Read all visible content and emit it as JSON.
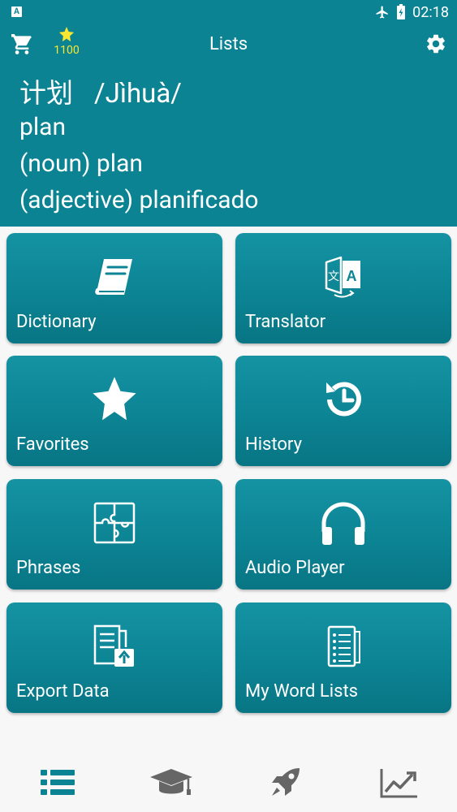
{
  "status_bar": {
    "left_icon_letter": "A",
    "time": "02:18",
    "icons": [
      "airplane-icon",
      "battery-charging-icon"
    ]
  },
  "header": {
    "title": "Lists",
    "points": "1100",
    "icons": {
      "cart": "cart-icon",
      "star": "star-icon",
      "settings": "gear-icon"
    }
  },
  "word": {
    "hanzi": "计划",
    "pinyin": "/Jìhuà/",
    "definitions": [
      "plan",
      "(noun) plan",
      "(adjective) planificado"
    ]
  },
  "tiles": [
    {
      "label": "Dictionary",
      "icon": "book-icon"
    },
    {
      "label": "Translator",
      "icon": "translate-icon"
    },
    {
      "label": "Favorites",
      "icon": "star-icon"
    },
    {
      "label": "History",
      "icon": "history-icon"
    },
    {
      "label": "Phrases",
      "icon": "puzzle-icon"
    },
    {
      "label": "Audio Player",
      "icon": "headphones-icon"
    },
    {
      "label": "Export Data",
      "icon": "export-document-icon"
    },
    {
      "label": "My Word Lists",
      "icon": "word-list-icon"
    }
  ],
  "bottom_nav": {
    "items": [
      {
        "icon": "list-icon",
        "active": true
      },
      {
        "icon": "graduation-cap-icon",
        "active": false
      },
      {
        "icon": "rocket-icon",
        "active": false
      },
      {
        "icon": "trend-chart-icon",
        "active": false
      }
    ]
  },
  "colors": {
    "primary": "#0b8392",
    "tile_gradient_top": "#1593a3",
    "tile_gradient_bottom": "#087584",
    "points_yellow": "#f7e733",
    "nav_active": "#0b8392",
    "nav_inactive": "#666666",
    "background": "#f7f7f7"
  }
}
